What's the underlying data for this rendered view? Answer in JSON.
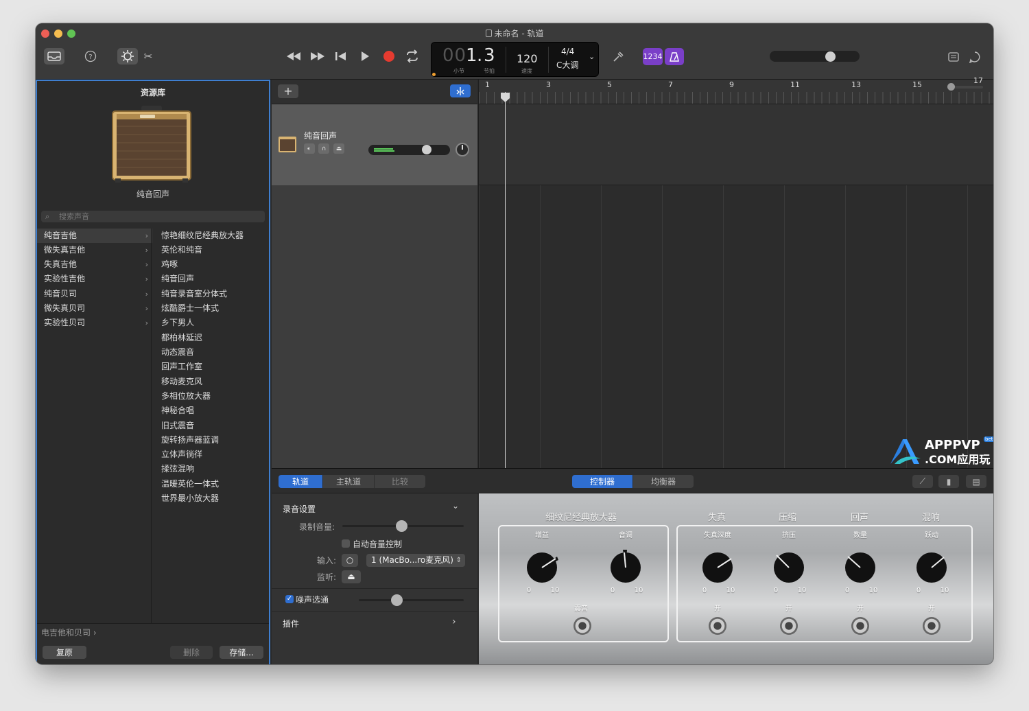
{
  "window": {
    "title": "未命名 - 轨道"
  },
  "lcd": {
    "bar": "1",
    "beat": "3",
    "bar_prefix": "00",
    "bar_label": "小节",
    "beat_label": "节拍",
    "tempo": "120",
    "tempo_label": "速度",
    "signature": "4/4",
    "key": "C大调"
  },
  "toolbar": {
    "count_in": "1234"
  },
  "library": {
    "title": "资源库",
    "selected_patch": "纯音回声",
    "search_placeholder": "搜索声音",
    "categories": [
      "纯音吉他",
      "微失真吉他",
      "失真吉他",
      "实验性吉他",
      "纯音贝司",
      "微失真贝司",
      "实验性贝司"
    ],
    "presets": [
      "惊艳细纹尼经典放大器",
      "英伦和纯音",
      "鸡啄",
      "纯音回声",
      "纯音录音室分体式",
      "炫酷爵士一体式",
      "乡下男人",
      "都柏林延迟",
      "动态震音",
      "回声工作室",
      "移动麦克风",
      "多相位放大器",
      "神秘合唱",
      "旧式震音",
      "旋转扬声器蓝调",
      "立体声徜徉",
      "揉弦混响",
      "温暖英伦一体式",
      "世界最小放大器"
    ],
    "footer_path": "电吉他和贝司 ›",
    "revert": "复原",
    "delete": "删除",
    "save": "存储..."
  },
  "track": {
    "name": "纯音回声"
  },
  "ruler": {
    "bars": [
      "1",
      "3",
      "5",
      "7",
      "9",
      "11",
      "13",
      "15",
      "17"
    ]
  },
  "editor": {
    "tabs": [
      "轨道",
      "主轨道",
      "比较"
    ],
    "view_tabs": [
      "控制器",
      "均衡器"
    ],
    "recording_settings": "录音设置",
    "record_level": "录制音量:",
    "auto_level": "自动音量控制",
    "input_label": "输入:",
    "input_value": "1 (MacBo...ro麦克风)",
    "monitor_label": "监听:",
    "noise_gate": "噪声选通",
    "plugins": "插件"
  },
  "amp": {
    "title": "细纹尼经典放大器",
    "sections": [
      "失真",
      "压缩",
      "回声",
      "混响"
    ],
    "knobs": [
      "增益",
      "音调",
      "失真深度",
      "挤压",
      "数量",
      "跃动"
    ],
    "tremolo": "震音",
    "on": "开",
    "scale_low": "0",
    "scale_high": "10"
  },
  "watermark": {
    "line1": "APPPVP",
    "line2": ".COM应用玩客",
    "badge": "beta"
  }
}
